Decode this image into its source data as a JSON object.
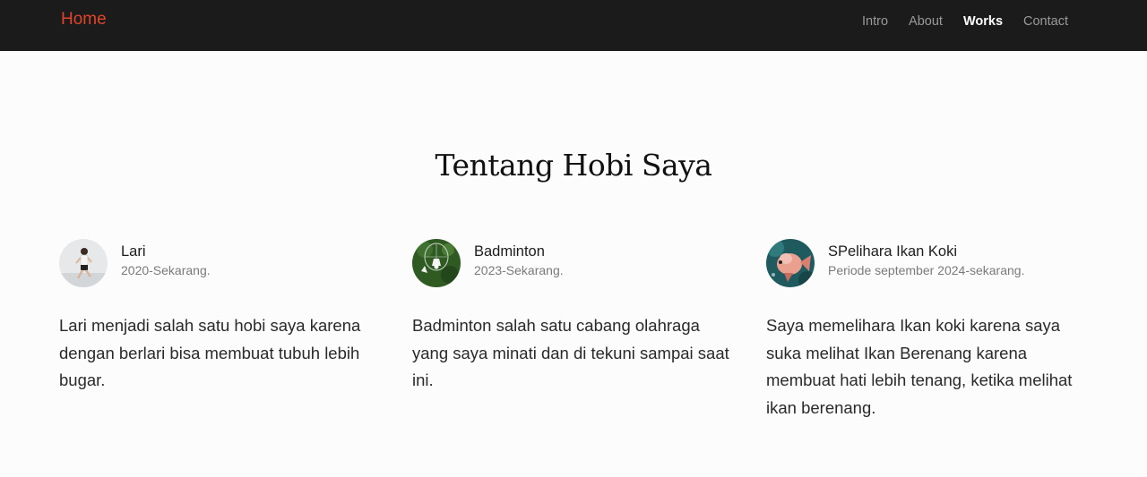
{
  "nav": {
    "brand": "Home",
    "links": [
      {
        "label": "Intro",
        "active": false
      },
      {
        "label": "About",
        "active": false
      },
      {
        "label": "Works",
        "active": true
      },
      {
        "label": "Contact",
        "active": false
      }
    ]
  },
  "section": {
    "title": "Tentang Hobi Saya"
  },
  "hobbies": [
    {
      "name": "Lari",
      "period": "2020-Sekarang.",
      "description": "Lari menjadi salah satu hobi saya karena dengan berlari bisa membuat tubuh lebih bugar.",
      "avatar_icon": "runner-photo"
    },
    {
      "name": "Badminton",
      "period": "2023-Sekarang.",
      "description": "Badminton salah satu cabang olahraga yang saya minati dan di tekuni sampai saat ini.",
      "avatar_icon": "shuttlecock-photo"
    },
    {
      "name": "SPelihara Ikan Koki",
      "period": "Periode september 2024-sekarang.",
      "description": "Saya memelihara Ikan koki karena saya suka melihat Ikan Berenang karena membuat hati lebih tenang, ketika melihat ikan berenang.",
      "avatar_icon": "goldfish-photo"
    }
  ],
  "colors": {
    "navbar_bg": "#1b1b1b",
    "brand": "#e0442b",
    "page_bg": "#fcfcfc"
  }
}
